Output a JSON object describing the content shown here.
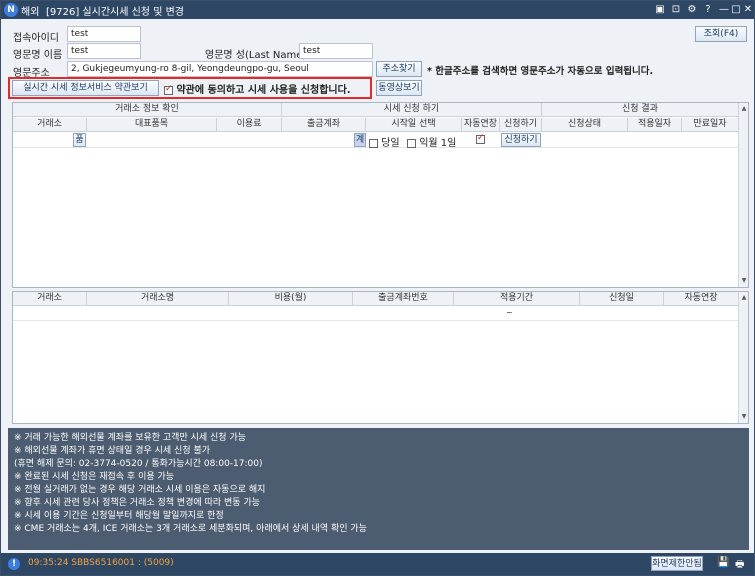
{
  "titlebar": {
    "logo": "N",
    "market": "해외",
    "title": "[9726] 실시간시세 신청 및 변경",
    "btn_pin": "▣",
    "btn_restore": "⊡",
    "btn_settings": "⚙",
    "btn_help": "?",
    "btn_min": "—",
    "btn_max": "□",
    "btn_close": "✕"
  },
  "form": {
    "login_id_label": "접속아이디",
    "login_id": "test",
    "eng_first_label": "영문명 이름",
    "eng_first": "test",
    "eng_last_label": "영문명 성(Last Name)",
    "eng_last": "test",
    "eng_addr_label": "영문주소",
    "eng_addr": "2, Gukjegeumyung-ro 8-gil, Yeongdeungpo-gu, Seoul",
    "addr_search": "주소찾기",
    "addr_hint": "* 한글주소를 검색하면 영문주소가 자동으로 입력됩니다.",
    "terms_btn": "실시간 시세 정보서비스 약관보기",
    "agree_text": "약관에 동의하고 시세 사용을 신청합니다.",
    "video_btn": "동영상보기",
    "query_btn": "조회(F4)"
  },
  "grid1": {
    "groups": [
      "거래소 정보 확인",
      "시세 신청 하기",
      "신청 결과"
    ],
    "headers": [
      "거래소",
      "대표품목",
      "이용료",
      "출금계좌",
      "시작일 선택",
      "자동연장",
      "신청하기",
      "신청상태",
      "적용일자",
      "만료일자"
    ],
    "row": {
      "product_btn": "품",
      "acct_btn": "계",
      "today": "당일",
      "next_month": "익월 1일",
      "apply_btn": "신청하기"
    }
  },
  "grid2": {
    "headers": [
      "거래소",
      "거래소명",
      "비용(월)",
      "출금계좌번호",
      "적용기간",
      "신청일",
      "자동연장"
    ],
    "period_sep": "~"
  },
  "notice": [
    "※ 거래 가능한 해외선물 계좌를 보유한 고객만 시세 신청 가능",
    "※ 해외선물 계좌가 휴면 상태일 경우 시세 신청 불가",
    "   (휴면 해제 문의: 02-3774-0520 / 통화가능시간 08:00-17:00)",
    "※ 완료된 시세 신청은 재접속 후 이용 가능",
    "※ 전월 실거래가 없는 경우 해당 거래소 시세 이용은 자동으로 해지",
    "※ 향후 시세 관련 당사 정책은 거래소 정책 변경에 따라 변동 가능",
    "※ 시세 이용 기간은 신청일부터 해당월 말일까지로 한정",
    "※ CME 거래소는 4개, ICE 거래소는 3개 거래소로 세분화되며, 아래에서 상세 내역 확인 가능"
  ],
  "status": {
    "icon": "!",
    "message": "09:35:24 SBBS6516001 : (5009)",
    "screen_limit": "화면제한안됨",
    "save_icon": "💾",
    "print_icon": "🖶"
  },
  "colors": {
    "title_bg": "#2e4764",
    "highlight": "#e12a2a",
    "notice_bg": "#4d5d71",
    "status_text": "#f4a33b"
  }
}
